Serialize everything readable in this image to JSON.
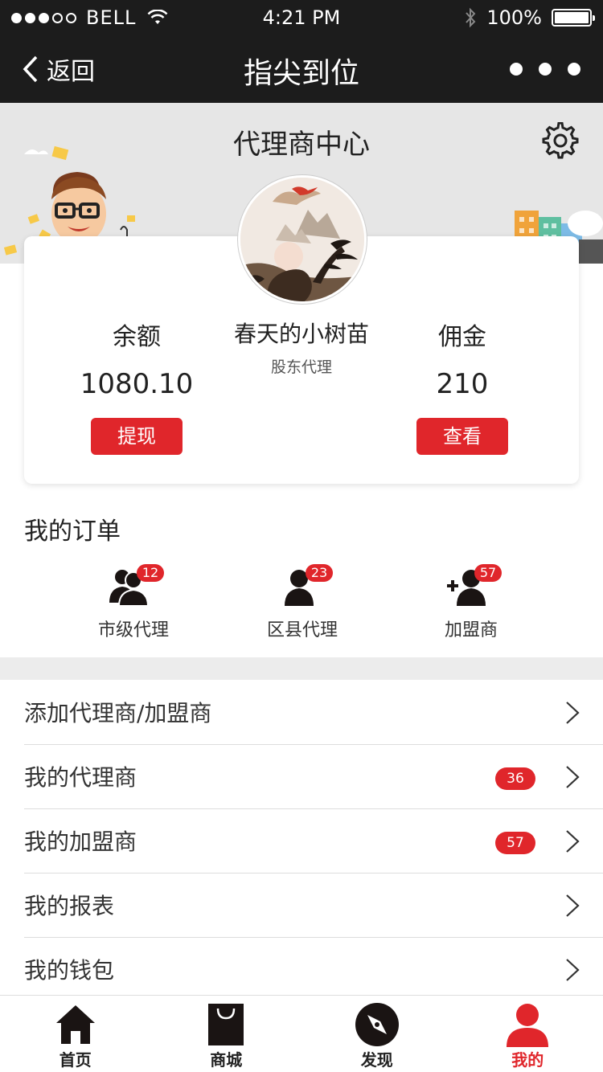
{
  "status": {
    "carrier": "BELL",
    "time": "4:21 PM",
    "battery": "100%"
  },
  "nav": {
    "back_label": "返回",
    "title": "指尖到位"
  },
  "header": {
    "title": "代理商中心"
  },
  "card": {
    "balance_label": "余额",
    "balance_value": "1080.10",
    "withdraw_label": "提现",
    "name": "春天的小树苗",
    "role": "股东代理",
    "commission_label": "佣金",
    "commission_value": "210",
    "view_label": "查看"
  },
  "orders": {
    "title": "我的订单",
    "items": [
      {
        "label": "市级代理",
        "badge": "12",
        "icon": "group-icon"
      },
      {
        "label": "区县代理",
        "badge": "23",
        "icon": "person-icon"
      },
      {
        "label": "加盟商",
        "badge": "57",
        "icon": "add-person-icon"
      }
    ]
  },
  "menu": {
    "items": [
      {
        "label": "添加代理商/加盟商",
        "badge": ""
      },
      {
        "label": "我的代理商",
        "badge": "36"
      },
      {
        "label": "我的加盟商",
        "badge": "57"
      },
      {
        "label": "我的报表",
        "badge": ""
      },
      {
        "label": "我的钱包",
        "badge": ""
      }
    ]
  },
  "tabs": [
    {
      "label": "首页",
      "icon": "home-icon"
    },
    {
      "label": "商城",
      "icon": "bag-icon"
    },
    {
      "label": "发现",
      "icon": "compass-icon"
    },
    {
      "label": "我的",
      "icon": "user-icon"
    }
  ],
  "colors": {
    "accent": "#e0262b",
    "bar": "#1c1c1c",
    "header_bg": "#e6e6e6"
  }
}
